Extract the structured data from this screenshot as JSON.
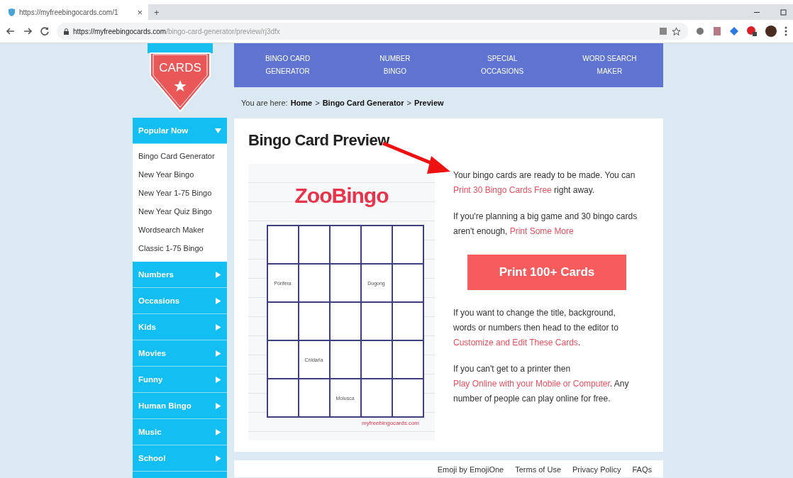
{
  "browser": {
    "tab_title": "https://myfreebingocards.com/1",
    "tab_close": "×",
    "new_tab": "+",
    "url_host": "https://myfreebingocards.com",
    "url_path": "/bingo-card-generator/preview/rj3dfx"
  },
  "logo": {
    "word": "CARDS"
  },
  "nav": [
    {
      "line1": "BINGO CARD",
      "line2": "GENERATOR"
    },
    {
      "line1": "NUMBER",
      "line2": "BINGO"
    },
    {
      "line1": "SPECIAL",
      "line2": "OCCASIONS"
    },
    {
      "line1": "WORD SEARCH",
      "line2": "MAKER"
    }
  ],
  "breadcrumb": {
    "prefix": "You are here:",
    "items": [
      "Home",
      "Bingo Card Generator",
      "Preview"
    ],
    "separator": ">"
  },
  "sidebar": {
    "sections": [
      {
        "label": "Popular Now",
        "expanded": true,
        "children": [
          "Bingo Card Generator",
          "New Year Bingo",
          "New Year 1-75 Bingo",
          "New Year Quiz Bingo",
          "Wordsearch Maker",
          "Classic 1-75 Bingo"
        ]
      },
      {
        "label": "Numbers",
        "expanded": false
      },
      {
        "label": "Occasions",
        "expanded": false
      },
      {
        "label": "Kids",
        "expanded": false
      },
      {
        "label": "Movies",
        "expanded": false
      },
      {
        "label": "Funny",
        "expanded": false
      },
      {
        "label": "Human Bingo",
        "expanded": false
      },
      {
        "label": "Music",
        "expanded": false
      },
      {
        "label": "School",
        "expanded": false
      },
      {
        "expanded": false
      }
    ]
  },
  "panel": {
    "title": "Bingo Card Preview",
    "card": {
      "title": "ZooBingo",
      "site": "myfreebingocards.com",
      "rows": [
        [
          "",
          "",
          "",
          "",
          ""
        ],
        [
          "Porifera",
          "",
          "",
          "Dugong",
          ""
        ],
        [
          "",
          "",
          "",
          "",
          ""
        ],
        [
          "",
          "Cnidaria",
          "",
          "",
          ""
        ],
        [
          "",
          "",
          "Molusca",
          "",
          ""
        ]
      ]
    },
    "paragraphs": [
      [
        {
          "text": "Your bingo cards are ready to be made. You can ",
          "link": false
        },
        {
          "text": "Print 30 Bingo Cards Free",
          "link": true
        },
        {
          "text": " right away.",
          "link": false
        }
      ],
      [
        {
          "text": "If you're planning a big game and 30 bingo cards aren't enough, ",
          "link": false
        },
        {
          "text": "Print Some More",
          "link": true
        }
      ]
    ],
    "button": "Print 100+ Cards",
    "paragraphs_after": [
      [
        {
          "text": "If you want to change the title, background, words or numbers then head to the editor to ",
          "link": false
        },
        {
          "text": "Customize and Edit These Cards",
          "link": true
        },
        {
          "text": ".",
          "link": false
        }
      ],
      [
        {
          "text": "If you can't get to a printer then ",
          "link": false
        },
        {
          "text": "Play Online with your Mobile or Computer",
          "link": true
        },
        {
          "text": ". Any number of people can play online for free.",
          "link": false
        }
      ]
    ]
  },
  "footer": [
    "Emoji by EmojiOne",
    "Terms of Use",
    "Privacy Policy",
    "FAQs"
  ]
}
